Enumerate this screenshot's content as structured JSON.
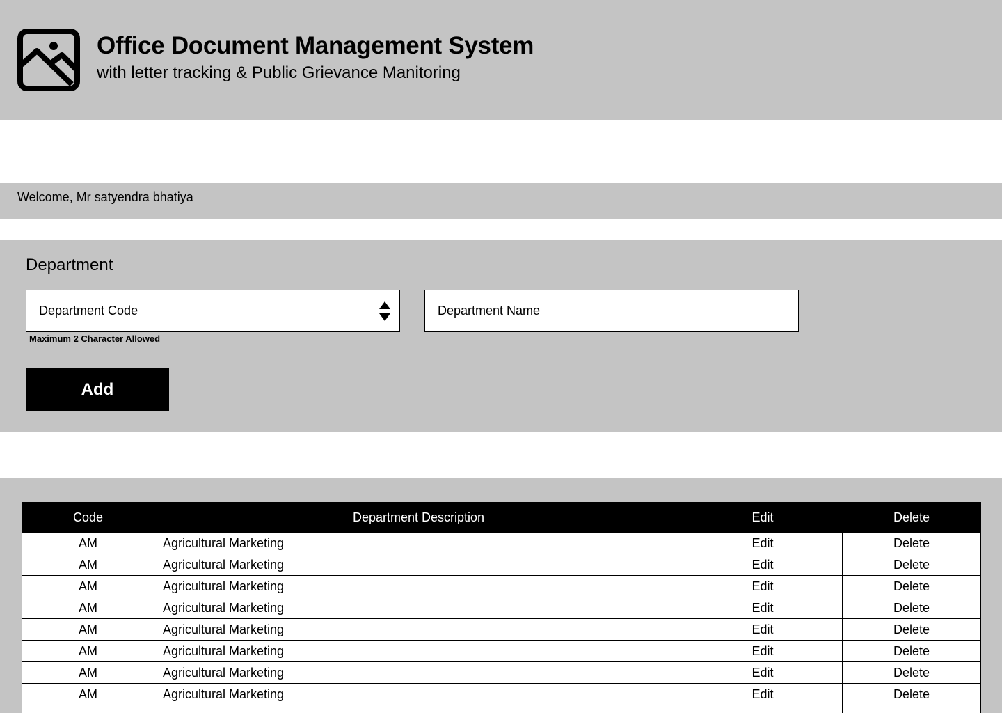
{
  "header": {
    "title": "Office Document Management System",
    "subtitle": "with letter tracking & Public Grievance Manitoring",
    "logo_icon": "image-placeholder-icon"
  },
  "welcome": {
    "text": "Welcome, Mr satyendra bhatiya"
  },
  "department_form": {
    "section_title": "Department",
    "code_placeholder": "Department Code",
    "name_placeholder": "Department Name",
    "code_hint": "Maximum 2 Character Allowed",
    "add_label": "Add"
  },
  "table": {
    "headers": [
      "Code",
      "Department Description",
      "Edit",
      "Delete"
    ],
    "rows": [
      {
        "code": "AM",
        "description": "Agricultural Marketing",
        "edit": "Edit",
        "delete": "Delete"
      },
      {
        "code": "AM",
        "description": "Agricultural Marketing",
        "edit": "Edit",
        "delete": "Delete"
      },
      {
        "code": "AM",
        "description": "Agricultural Marketing",
        "edit": "Edit",
        "delete": "Delete"
      },
      {
        "code": "AM",
        "description": "Agricultural Marketing",
        "edit": "Edit",
        "delete": "Delete"
      },
      {
        "code": "AM",
        "description": "Agricultural Marketing",
        "edit": "Edit",
        "delete": "Delete"
      },
      {
        "code": "AM",
        "description": "Agricultural Marketing",
        "edit": "Edit",
        "delete": "Delete"
      },
      {
        "code": "AM",
        "description": "Agricultural Marketing",
        "edit": "Edit",
        "delete": "Delete"
      },
      {
        "code": "AM",
        "description": "Agricultural Marketing",
        "edit": "Edit",
        "delete": "Delete"
      },
      {
        "code": "",
        "description": "",
        "edit": "",
        "delete": ""
      }
    ]
  },
  "colors": {
    "panel_gray": "#c4c4c4",
    "primary_black": "#000000",
    "surface_white": "#ffffff"
  }
}
